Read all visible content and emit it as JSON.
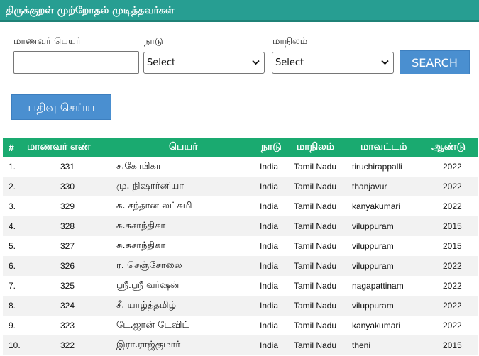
{
  "header": {
    "title": "திருக்குறள் முற்றோதல் முடித்தவர்கள்"
  },
  "filters": {
    "name_label": "மாணவர் பெயர்",
    "name_value": "",
    "country_label": "நாடு",
    "country_selected": "Select",
    "state_label": "மாநிலம்",
    "state_selected": "Select",
    "search_label": "SEARCH",
    "register_label": "பதிவு செய்ய"
  },
  "table": {
    "columns": [
      "#",
      "மாணவர் எண்",
      "பெயர்",
      "நாடு",
      "மாநிலம்",
      "மாவட்டம்",
      "ஆண்டு"
    ],
    "rows": [
      [
        "1.",
        "331",
        "ச.கோபிகா",
        "India",
        "Tamil Nadu",
        "tiruchirappalli",
        "2022"
      ],
      [
        "2.",
        "330",
        "மு. நிஷார்னியா",
        "India",
        "Tamil Nadu",
        "thanjavur",
        "2022"
      ],
      [
        "3.",
        "329",
        "க. சந்தான லட்சுமி",
        "India",
        "Tamil Nadu",
        "kanyakumari",
        "2022"
      ],
      [
        "4.",
        "328",
        "சு.சுசாந்திகா",
        "India",
        "Tamil Nadu",
        "viluppuram",
        "2015"
      ],
      [
        "5.",
        "327",
        "சு.சுசாந்திகா",
        "India",
        "Tamil Nadu",
        "viluppuram",
        "2015"
      ],
      [
        "6.",
        "326",
        "ர. செஞ்சோலை",
        "India",
        "Tamil Nadu",
        "viluppuram",
        "2022"
      ],
      [
        "7.",
        "325",
        "ஸ்ரீ.ஸ்ரீ வர்ஷன்",
        "India",
        "Tamil Nadu",
        "nagapattinam",
        "2022"
      ],
      [
        "8.",
        "324",
        "சீ. யாழ்த்தமிழ்",
        "India",
        "Tamil Nadu",
        "viluppuram",
        "2022"
      ],
      [
        "9.",
        "323",
        "டே.ஜான் டேவிட்",
        "India",
        "Tamil Nadu",
        "kanyakumari",
        "2022"
      ],
      [
        "10.",
        "322",
        "இரா.ராஜ்குமார்",
        "India",
        "Tamil Nadu",
        "theni",
        "2015"
      ]
    ]
  },
  "icons": {
    "select_arrow": "chevron-down-icon"
  },
  "colors": {
    "header_bg": "#279e92",
    "table_header_bg": "#1aaa70",
    "button_bg": "#4a8fd0"
  }
}
